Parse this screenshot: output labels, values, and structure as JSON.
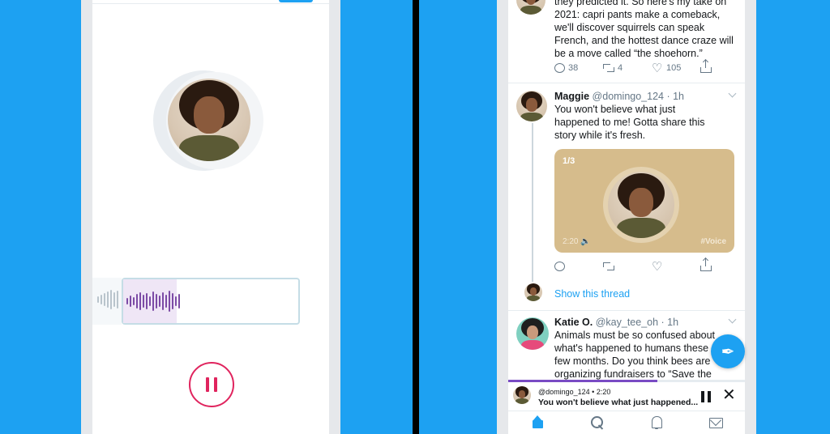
{
  "colors": {
    "background": "#1da1f2",
    "record_accent": "#e0245e",
    "wave": "#7c4ba6",
    "link": "#1da1f2"
  },
  "left_phone": {
    "recorder": {
      "pause_icon": "pause-icon"
    }
  },
  "right_phone": {
    "tweet_top": {
      "text_lines": [
        "they predicted it. So here's my take on",
        "2021: capri pants make a comeback,",
        "we'll discover squirrels can speak",
        "French, and the hottest dance craze will",
        "be a move called “the shoehorn.”"
      ],
      "replies": "38",
      "retweets": "4",
      "likes": "105"
    },
    "tweet_maggie": {
      "name": "Maggie",
      "meta": "@domingo_124 · 1h",
      "text_lines": [
        "You won't believe what just",
        "happened to me! Gotta share this",
        "story while it's fresh."
      ],
      "card": {
        "count": "1/3",
        "time": "2:20 🔈",
        "tag": "#Voice"
      },
      "show_thread": "Show this thread"
    },
    "tweet_katie": {
      "name": "Katie O.",
      "meta": "@kay_tee_oh · 1h",
      "text_lines": [
        "Animals must be so confused about",
        "what's happened to humans these",
        "few months. Do you think bees are",
        "organizing fundraisers to “Save the"
      ]
    },
    "player": {
      "handle": "@domingo_124 • 2:20",
      "title": "You won't believe what just happened...",
      "close_glyph": "✕",
      "progress_pct": 63
    },
    "compose_glyph": "✒",
    "tabs": [
      "home-icon",
      "search-icon",
      "notifications-icon",
      "messages-icon"
    ]
  }
}
